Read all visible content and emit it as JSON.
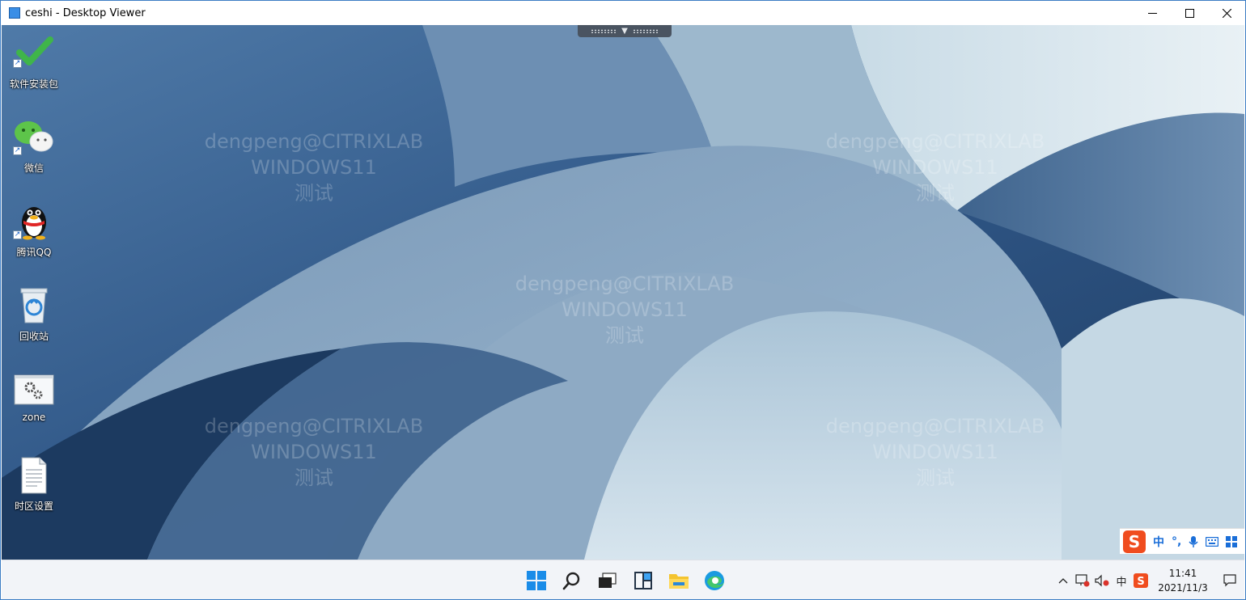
{
  "window": {
    "title": "ceshi - Desktop Viewer"
  },
  "desktop_icons": [
    {
      "label": "软件安装包",
      "icon": "checkmark-icon"
    },
    {
      "label": "微信",
      "icon": "wechat-icon"
    },
    {
      "label": "腾讯QQ",
      "icon": "qq-penguin-icon"
    },
    {
      "label": "回收站",
      "icon": "recycle-bin-icon"
    },
    {
      "label": "zone",
      "icon": "gears-icon"
    },
    {
      "label": "时区设置",
      "icon": "text-file-icon"
    }
  ],
  "watermark": {
    "line1": "dengpeng@CITRIXLAB",
    "line2": "WINDOWS11",
    "line3": "测试"
  },
  "ime": {
    "logo": "S",
    "lang": "中",
    "punct": "°,",
    "mic": "mic-icon",
    "keyboard": "keyboard-icon",
    "grid": "grid-icon"
  },
  "tray": {
    "lang": "中",
    "time": "11:41",
    "date": "2021/11/3"
  },
  "colors": {
    "accent": "#0078d4",
    "sogou": "#f04c1e",
    "ime_blue": "#1a6ed8"
  }
}
